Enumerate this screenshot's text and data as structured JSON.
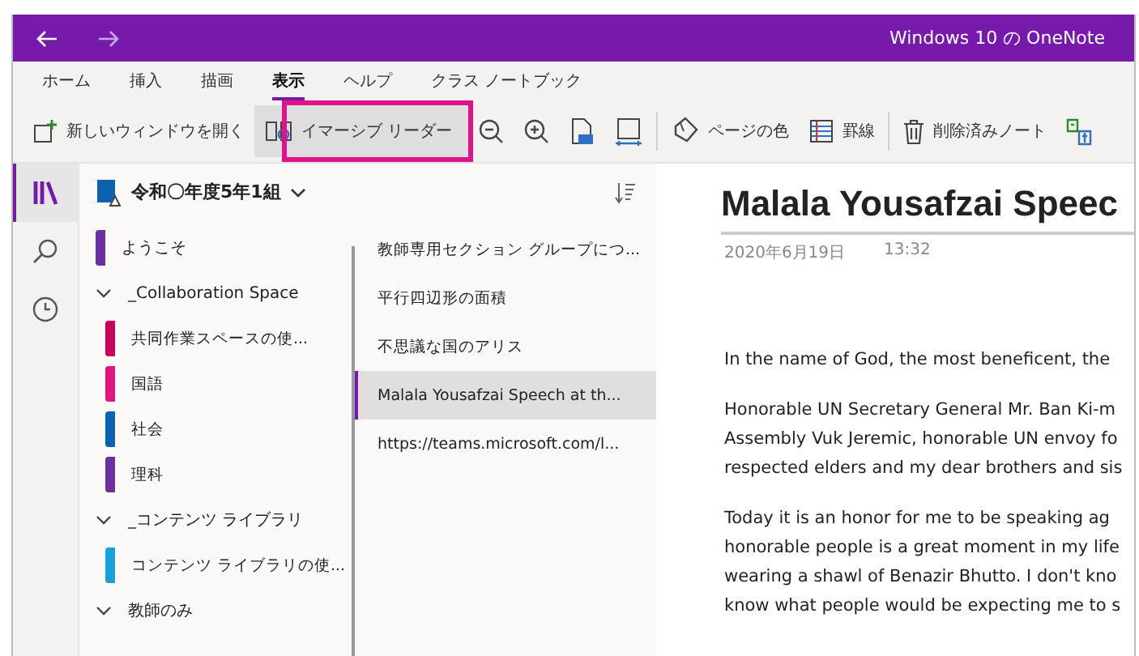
{
  "window": {
    "title": "Windows 10 の OneNote"
  },
  "tabs": [
    {
      "label": "ホーム",
      "selected": false
    },
    {
      "label": "挿入",
      "selected": false
    },
    {
      "label": "描画",
      "selected": false
    },
    {
      "label": "表示",
      "selected": true
    },
    {
      "label": "ヘルプ",
      "selected": false
    },
    {
      "label": "クラス ノートブック",
      "selected": false
    }
  ],
  "toolbar": [
    {
      "kind": "new-window",
      "label": "新しいウィンドウを開く",
      "highlighted": false
    },
    {
      "kind": "immersive-reader",
      "label": "イマーシブ リーダー",
      "highlighted": true
    },
    {
      "kind": "zoom-out",
      "highlighted": false
    },
    {
      "kind": "zoom-in",
      "highlighted": false
    },
    {
      "kind": "actual-size",
      "highlighted": false
    },
    {
      "kind": "page-width",
      "highlighted": false
    },
    {
      "kind": "page-color",
      "label": "ページの色",
      "highlighted": false
    },
    {
      "kind": "rule-lines",
      "label": "罫線",
      "highlighted": false
    },
    {
      "kind": "deleted-notes",
      "label": "削除済みノート",
      "highlighted": false
    },
    {
      "kind": "translate",
      "highlighted": false
    }
  ],
  "notebook": {
    "name": "令和〇年度5年1組"
  },
  "sections": [
    {
      "label": "ようこそ",
      "color": "#6b2fa0"
    },
    {
      "label": "_Collaboration Space",
      "expanded": true,
      "children": [
        {
          "label": "共同作業スペースの使...",
          "color": "#c8005a"
        },
        {
          "label": "国語",
          "color": "#e0157f"
        },
        {
          "label": "社会",
          "color": "#0b63b0"
        },
        {
          "label": "理科",
          "color": "#6b2fa0"
        }
      ]
    },
    {
      "label": "_コンテンツ ライブラリ",
      "expanded": true,
      "children": [
        {
          "label": "コンテンツ ライブラリの使...",
          "color": "#1aa0d8"
        }
      ]
    },
    {
      "label": "教師のみ",
      "expanded": true
    }
  ],
  "pages": [
    {
      "title": "教師専用セクション グループにつ...",
      "selected": false
    },
    {
      "title": "平行四辺形の面積",
      "selected": false
    },
    {
      "title": "不思議な国のアリス",
      "selected": false
    },
    {
      "title": "Malala Yousafzai Speech at th...",
      "selected": true
    },
    {
      "title": "https://teams.microsoft.com/l...",
      "selected": false
    }
  ],
  "page": {
    "title": "Malala Yousafzai Speec",
    "date": "2020年6月19日",
    "time": "13:32",
    "paragraphs": [
      [
        "In the name of God, the most beneficent, the"
      ],
      [
        "Honorable UN Secretary General Mr. Ban Ki-m",
        "Assembly Vuk Jeremic, honorable UN envoy fo",
        "respected elders and my dear brothers and sis"
      ],
      [
        "Today it is an honor for me to be speaking ag",
        "honorable people is a great moment in my life",
        "wearing a shawl of Benazir Bhutto. I don't kno",
        "know what people would be expecting me to s"
      ]
    ]
  }
}
